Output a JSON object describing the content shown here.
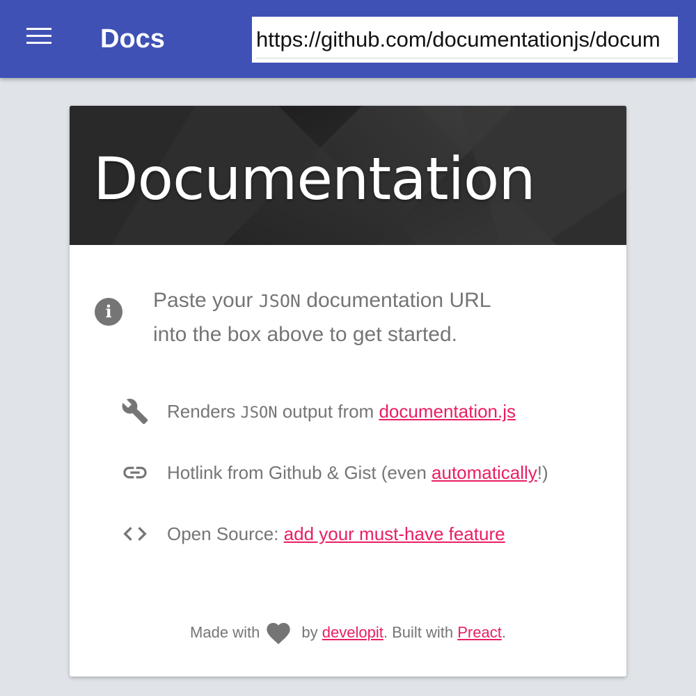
{
  "header": {
    "title": "Docs",
    "url_value": "https://github.com/documentationjs/docum",
    "background_color": "#3f51b5"
  },
  "hero": {
    "title": "Documentation"
  },
  "info": {
    "icon": "info-icon",
    "text_before": "Paste your ",
    "text_code": "JSON",
    "text_after_line1": " documentation URL",
    "text_line2": "into the box above to get started."
  },
  "features": [
    {
      "icon": "wrench-icon",
      "text_before": "Renders ",
      "code": "JSON",
      "text_mid": " output from ",
      "link": "documentation.js",
      "text_after": ""
    },
    {
      "icon": "link-icon",
      "text_before": "Hotlink from Github & Gist (even ",
      "link": "automatically",
      "text_after": "!)"
    },
    {
      "icon": "code-icon",
      "text_before": "Open Source: ",
      "link": "add your must-have feature",
      "text_after": ""
    }
  ],
  "footer": {
    "made_with": "Made with",
    "by": " by ",
    "author_link": "developit",
    "built_with": ". Built with ",
    "lib_link": "Preact",
    "end": "."
  },
  "colors": {
    "link": "#e91e63",
    "muted_text": "#757575",
    "page_background": "#e0e3e8"
  }
}
